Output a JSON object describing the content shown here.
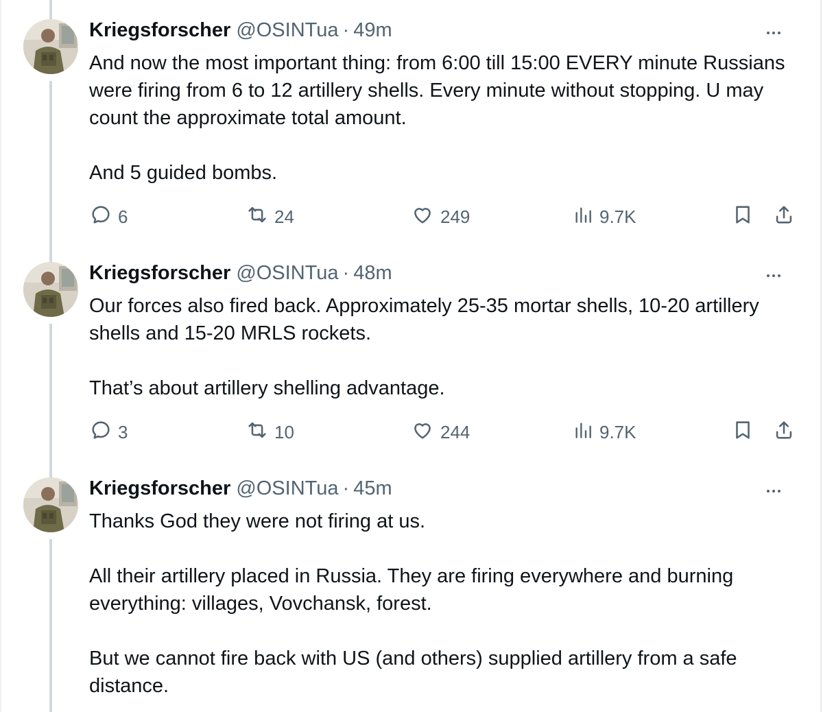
{
  "tweets": [
    {
      "author": {
        "name": "Kriegsforscher",
        "handle": "@OSINTua",
        "separator": "·",
        "time": "49m"
      },
      "paragraphs": [
        "And now the most important thing: from 6:00 till 15:00 EVERY minute Russians were firing from 6 to 12 artillery shells. Every minute without stopping. U may count the approximate total amount.",
        "And 5 guided bombs."
      ],
      "stats": {
        "replies": "6",
        "reposts": "24",
        "likes": "249",
        "views": "9.7K"
      }
    },
    {
      "author": {
        "name": "Kriegsforscher",
        "handle": "@OSINTua",
        "separator": "·",
        "time": "48m"
      },
      "paragraphs": [
        "Our forces also fired back. Approximately 25-35 mortar shells, 10-20 artillery shells and 15-20 MRLS rockets.",
        "That’s about artillery shelling advantage."
      ],
      "stats": {
        "replies": "3",
        "reposts": "10",
        "likes": "244",
        "views": "9.7K"
      }
    },
    {
      "author": {
        "name": "Kriegsforscher",
        "handle": "@OSINTua",
        "separator": "·",
        "time": "45m"
      },
      "paragraphs": [
        "Thanks God they were not firing at us.",
        "All their artillery placed in Russia. They are firing everywhere and burning everything: villages, Vovchansk, forest.",
        "But we cannot fire back with US (and others) supplied artillery from a safe distance."
      ]
    }
  ],
  "icons": {
    "reply": "reply-icon",
    "repost": "repost-icon",
    "like": "heart-icon",
    "views": "views-icon",
    "bookmark": "bookmark-icon",
    "share": "share-icon",
    "more": "more-icon"
  },
  "colors": {
    "text": "#0f1419",
    "secondary": "#536471",
    "thread_line": "#cfd9de"
  }
}
